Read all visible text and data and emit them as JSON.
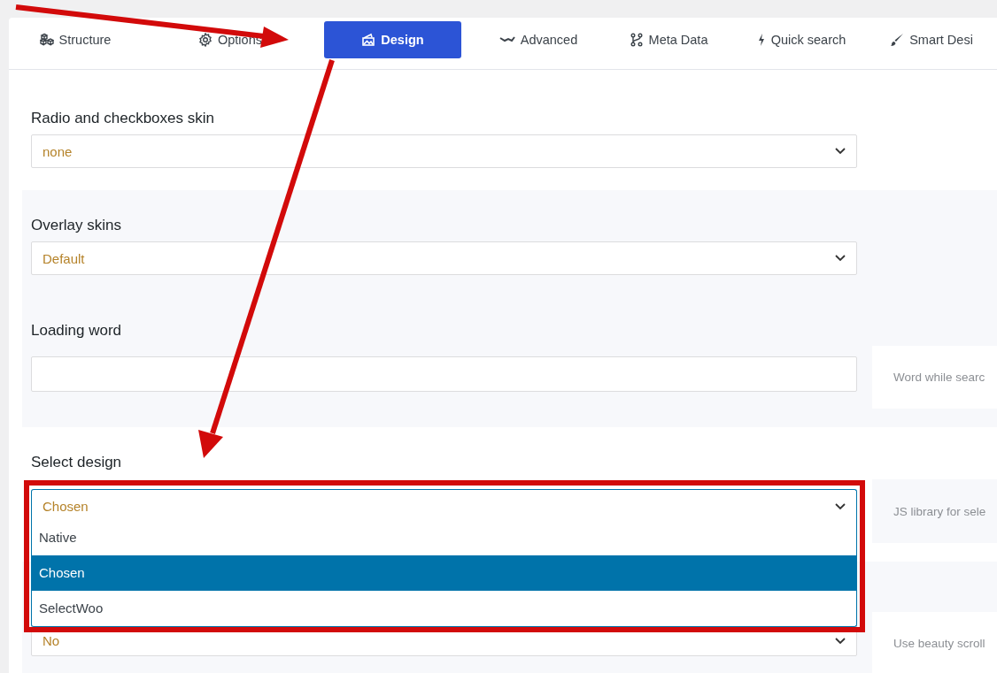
{
  "tabs": [
    {
      "label": "Structure",
      "selected": false
    },
    {
      "label": "Options",
      "selected": false
    },
    {
      "label": "Design",
      "selected": true
    },
    {
      "label": "Advanced",
      "selected": false
    },
    {
      "label": "Meta Data",
      "selected": false
    },
    {
      "label": "Quick search",
      "selected": false
    },
    {
      "label": "Smart Desi",
      "selected": false
    }
  ],
  "settings": [
    {
      "kind": "select",
      "label": "Radio and checkboxes skin",
      "value": "none",
      "expanded": false
    },
    {
      "kind": "select",
      "label": "Overlay skins",
      "value": "Default",
      "expanded": false
    },
    {
      "kind": "text",
      "label": "Loading word",
      "hint": "Word while searc"
    },
    {
      "kind": "select",
      "label": "Select design",
      "value": "Chosen",
      "expanded": true,
      "hint": "JS library for sele",
      "options": [
        {
          "label": "Native",
          "selected": false
        },
        {
          "label": "Chosen",
          "selected": true
        },
        {
          "label": "SelectWoo",
          "selected": false
        }
      ]
    },
    {
      "kind": "select",
      "value": "No",
      "expanded": false,
      "hint": "Use beauty scroll"
    }
  ]
}
